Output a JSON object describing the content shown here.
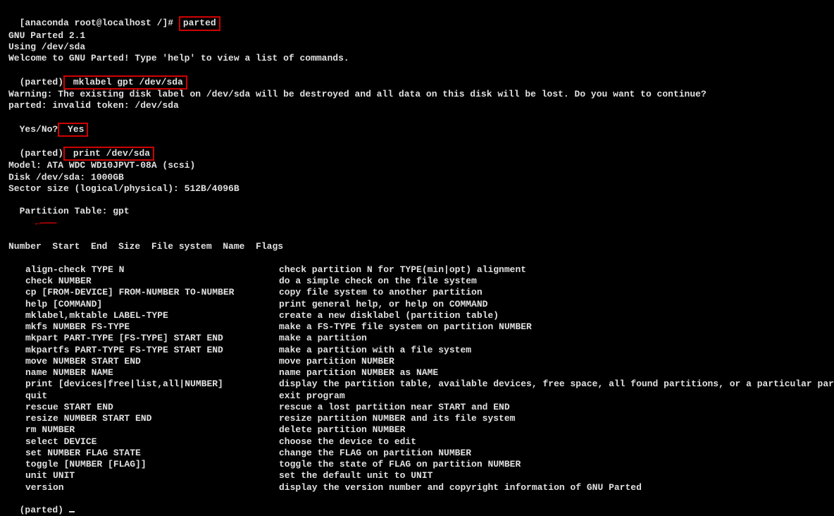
{
  "prompt_root": "[anaconda root@localhost /]# ",
  "cmd_parted": "parted",
  "lines_intro": [
    "GNU Parted 2.1",
    "Using /dev/sda",
    "Welcome to GNU Parted! Type 'help' to view a list of commands."
  ],
  "prompt_parted_open": "(parted)",
  "cmd_mklabel": " mklabel gpt /dev/sda",
  "line_warn": "Warning: The existing disk label on /dev/sda will be destroyed and all data on this disk will be lost. Do you want to continue?",
  "line_invalid": "parted: invalid token: /dev/sda",
  "prompt_yesno": "Yes/No?",
  "ans_yes": " Yes",
  "cmd_print": " print /dev/sda",
  "disk_info": [
    "Model: ATA WDC WD10JPVT-08A (scsi)",
    "Disk /dev/sda: 1000GB",
    "Sector size (logical/physical): 512B/4096B",
    "Partition Table: gpt"
  ],
  "header_row": "Number  Start  End  Size  File system  Name  Flags",
  "help": [
    {
      "l": "align-check TYPE N",
      "r": "check partition N for TYPE(min|opt) alignment"
    },
    {
      "l": "check NUMBER",
      "r": "do a simple check on the file system"
    },
    {
      "l": "cp [FROM-DEVICE] FROM-NUMBER TO-NUMBER",
      "r": "copy file system to another partition"
    },
    {
      "l": "help [COMMAND]",
      "r": "print general help, or help on COMMAND"
    },
    {
      "l": "mklabel,mktable LABEL-TYPE",
      "r": "create a new disklabel (partition table)"
    },
    {
      "l": "mkfs NUMBER FS-TYPE",
      "r": "make a FS-TYPE file system on partition NUMBER"
    },
    {
      "l": "mkpart PART-TYPE [FS-TYPE] START END",
      "r": "make a partition"
    },
    {
      "l": "mkpartfs PART-TYPE FS-TYPE START END",
      "r": "make a partition with a file system"
    },
    {
      "l": "move NUMBER START END",
      "r": "move partition NUMBER"
    },
    {
      "l": "name NUMBER NAME",
      "r": "name partition NUMBER as NAME"
    },
    {
      "l": "print [devices|free|list,all|NUMBER]",
      "r": "display the partition table, available devices, free space, all found partitions, or a particular partition"
    },
    {
      "l": "quit",
      "r": "exit program"
    },
    {
      "l": "rescue START END",
      "r": "rescue a lost partition near START and END"
    },
    {
      "l": "resize NUMBER START END",
      "r": "resize partition NUMBER and its file system"
    },
    {
      "l": "rm NUMBER",
      "r": "delete partition NUMBER"
    },
    {
      "l": "select DEVICE",
      "r": "choose the device to edit"
    },
    {
      "l": "set NUMBER FLAG STATE",
      "r": "change the FLAG on partition NUMBER"
    },
    {
      "l": "toggle [NUMBER [FLAG]]",
      "r": "toggle the state of FLAG on partition NUMBER"
    },
    {
      "l": "unit UNIT",
      "r": "set the default unit to UNIT"
    },
    {
      "l": "version",
      "r": "display the version number and copyright information of GNU Parted"
    }
  ],
  "prompt_final": "(parted) "
}
